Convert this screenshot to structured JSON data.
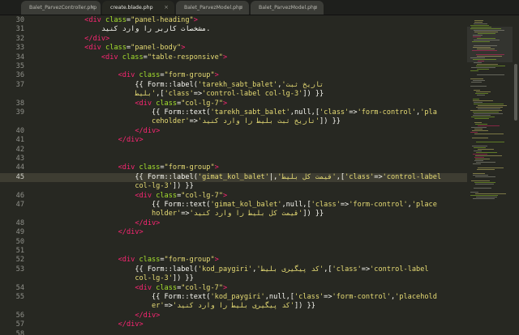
{
  "tabs": [
    {
      "label": "Balet_ParvezController.php",
      "active": false
    },
    {
      "label": "create.blade.php",
      "active": true
    },
    {
      "label": "Balet_ParvezModel.php",
      "active": false
    },
    {
      "label": "Balet_ParvezModel.php",
      "active": false
    }
  ],
  "close_glyph": "×",
  "current_line": "45",
  "lines": [
    {
      "n": "30",
      "segs": [
        [
          "t",
          "<div "
        ],
        [
          "a",
          "class"
        ],
        [
          "p",
          "="
        ],
        [
          "s",
          "\"panel-heading\""
        ],
        [
          "t",
          ">"
        ]
      ],
      "indent": 12
    },
    {
      "n": "31",
      "segs": [
        [
          "p",
          "مشخصات کاربر را وارد کنید."
        ]
      ],
      "indent": 16
    },
    {
      "n": "32",
      "segs": [
        [
          "t",
          "</div>"
        ]
      ],
      "indent": 12
    },
    {
      "n": "33",
      "segs": [
        [
          "t",
          "<div "
        ],
        [
          "a",
          "class"
        ],
        [
          "p",
          "="
        ],
        [
          "s",
          "\"panel-body\""
        ],
        [
          "t",
          ">"
        ]
      ],
      "indent": 12
    },
    {
      "n": "34",
      "segs": [
        [
          "t",
          "<div "
        ],
        [
          "a",
          "class"
        ],
        [
          "p",
          "="
        ],
        [
          "s",
          "\"table-responsive\""
        ],
        [
          "t",
          ">"
        ]
      ],
      "indent": 16
    },
    {
      "n": "35",
      "segs": [],
      "indent": 0
    },
    {
      "n": "36",
      "segs": [
        [
          "t",
          "<div "
        ],
        [
          "a",
          "class"
        ],
        [
          "p",
          "="
        ],
        [
          "s",
          "\"form-group\""
        ],
        [
          "t",
          ">"
        ]
      ],
      "indent": 20
    },
    {
      "n": "37",
      "segs": [
        [
          "p",
          "{{ Form::label("
        ],
        [
          "s",
          "'tarekh_sabt_balet'"
        ],
        [
          "p",
          ","
        ],
        [
          "s",
          "'تاریخ ثبت"
        ]
      ],
      "indent": 24
    },
    {
      "n": "",
      "segs": [
        [
          "s",
          "بلیط'"
        ],
        [
          "p",
          ",["
        ],
        [
          "s",
          "'class'"
        ],
        [
          "p",
          "=>"
        ],
        [
          "s",
          "'control-label col-lg-3'"
        ],
        [
          "p",
          "]) }}"
        ]
      ],
      "indent": 24
    },
    {
      "n": "38",
      "segs": [
        [
          "t",
          "<div "
        ],
        [
          "a",
          "class"
        ],
        [
          "p",
          "="
        ],
        [
          "s",
          "\"col-lg-7\""
        ],
        [
          "t",
          ">"
        ]
      ],
      "indent": 24
    },
    {
      "n": "39",
      "segs": [
        [
          "p",
          "{{ Form::text("
        ],
        [
          "s",
          "'tarekh_sabt_balet'"
        ],
        [
          "p",
          ",null,["
        ],
        [
          "s",
          "'class'"
        ],
        [
          "p",
          "=>"
        ],
        [
          "s",
          "'form-control'"
        ],
        [
          "p",
          ","
        ],
        [
          "s",
          "'pla"
        ]
      ],
      "indent": 28
    },
    {
      "n": "",
      "segs": [
        [
          "s",
          "ceholder'"
        ],
        [
          "p",
          "=>"
        ],
        [
          "s",
          "'تاریخ ثبت بلیط را وارد کنید'"
        ],
        [
          "p",
          "]) }}"
        ]
      ],
      "indent": 28
    },
    {
      "n": "40",
      "segs": [
        [
          "t",
          "</div>"
        ]
      ],
      "indent": 24
    },
    {
      "n": "41",
      "segs": [
        [
          "t",
          "</div>"
        ]
      ],
      "indent": 20
    },
    {
      "n": "42",
      "segs": [],
      "indent": 0
    },
    {
      "n": "43",
      "segs": [],
      "indent": 0
    },
    {
      "n": "44",
      "segs": [
        [
          "t",
          "<div "
        ],
        [
          "a",
          "class"
        ],
        [
          "p",
          "="
        ],
        [
          "s",
          "\"form-group\""
        ],
        [
          "t",
          ">"
        ]
      ],
      "indent": 20
    },
    {
      "n": "45",
      "segs": [
        [
          "p",
          "{{ Form::label("
        ],
        [
          "s",
          "'gimat_kol_balet'"
        ],
        [
          "p",
          "|,"
        ],
        [
          "s",
          "'قیمت کل بلیط'"
        ],
        [
          "p",
          ",["
        ],
        [
          "s",
          "'class'"
        ],
        [
          "p",
          "=>"
        ],
        [
          "s",
          "'control-label"
        ]
      ],
      "indent": 24
    },
    {
      "n": "",
      "segs": [
        [
          "s",
          "col-lg-3'"
        ],
        [
          "p",
          "]) }}"
        ]
      ],
      "indent": 24
    },
    {
      "n": "46",
      "segs": [
        [
          "t",
          "<div "
        ],
        [
          "a",
          "class"
        ],
        [
          "p",
          "="
        ],
        [
          "s",
          "\"col-lg-7\""
        ],
        [
          "t",
          ">"
        ]
      ],
      "indent": 24
    },
    {
      "n": "47",
      "segs": [
        [
          "p",
          "{{ Form::text("
        ],
        [
          "s",
          "'gimat_kol_balet'"
        ],
        [
          "p",
          ",null,["
        ],
        [
          "s",
          "'class'"
        ],
        [
          "p",
          "=>"
        ],
        [
          "s",
          "'form-control'"
        ],
        [
          "p",
          ","
        ],
        [
          "s",
          "'place"
        ]
      ],
      "indent": 28
    },
    {
      "n": "",
      "segs": [
        [
          "s",
          "holder'"
        ],
        [
          "p",
          "=>"
        ],
        [
          "s",
          "'قیمت کل بلیط را وارد کنید'"
        ],
        [
          "p",
          "]) }}"
        ]
      ],
      "indent": 28
    },
    {
      "n": "48",
      "segs": [
        [
          "t",
          "</div>"
        ]
      ],
      "indent": 24
    },
    {
      "n": "49",
      "segs": [
        [
          "t",
          "</div>"
        ]
      ],
      "indent": 20
    },
    {
      "n": "50",
      "segs": [],
      "indent": 0
    },
    {
      "n": "51",
      "segs": [],
      "indent": 0
    },
    {
      "n": "52",
      "segs": [
        [
          "t",
          "<div "
        ],
        [
          "a",
          "class"
        ],
        [
          "p",
          "="
        ],
        [
          "s",
          "\"form-group\""
        ],
        [
          "t",
          ">"
        ]
      ],
      "indent": 20
    },
    {
      "n": "53",
      "segs": [
        [
          "p",
          "{{ Form::label("
        ],
        [
          "s",
          "'kod_paygiri'"
        ],
        [
          "p",
          ","
        ],
        [
          "s",
          "'کد پیگیری بلیط'"
        ],
        [
          "p",
          ",["
        ],
        [
          "s",
          "'class'"
        ],
        [
          "p",
          "=>"
        ],
        [
          "s",
          "'control-label"
        ]
      ],
      "indent": 24
    },
    {
      "n": "",
      "segs": [
        [
          "s",
          "col-lg-3'"
        ],
        [
          "p",
          "]) }}"
        ]
      ],
      "indent": 24
    },
    {
      "n": "54",
      "segs": [
        [
          "t",
          "<div "
        ],
        [
          "a",
          "class"
        ],
        [
          "p",
          "="
        ],
        [
          "s",
          "\"col-lg-7\""
        ],
        [
          "t",
          ">"
        ]
      ],
      "indent": 24
    },
    {
      "n": "55",
      "segs": [
        [
          "p",
          "{{ Form::text("
        ],
        [
          "s",
          "'kod_paygiri'"
        ],
        [
          "p",
          ",null,["
        ],
        [
          "s",
          "'class'"
        ],
        [
          "p",
          "=>"
        ],
        [
          "s",
          "'form-control'"
        ],
        [
          "p",
          ","
        ],
        [
          "s",
          "'placehold"
        ]
      ],
      "indent": 28
    },
    {
      "n": "",
      "segs": [
        [
          "s",
          "er'"
        ],
        [
          "p",
          "=>"
        ],
        [
          "s",
          "'کد پیگیری بلیط را وارد کنید'"
        ],
        [
          "p",
          "]) }}"
        ]
      ],
      "indent": 28
    },
    {
      "n": "56",
      "segs": [
        [
          "t",
          "</div>"
        ]
      ],
      "indent": 24
    },
    {
      "n": "57",
      "segs": [
        [
          "t",
          "</div>"
        ]
      ],
      "indent": 20
    },
    {
      "n": "58",
      "segs": [],
      "indent": 0
    }
  ],
  "colors": {
    "background": "#272822",
    "tag": "#f92672",
    "attribute": "#a6e22e",
    "string": "#e6db74",
    "text": "#f8f8f2",
    "line_number": "#8f908a"
  }
}
